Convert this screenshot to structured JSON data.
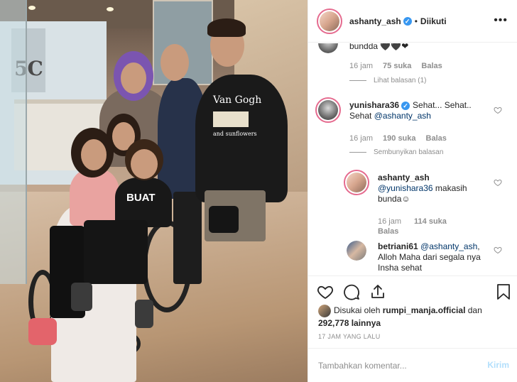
{
  "header": {
    "username": "ashanty_ash",
    "verified": true,
    "separator": "•",
    "follow_status": "Diikuti",
    "more_icon": "more-horizontal-icon"
  },
  "comments": [
    {
      "id": "partial",
      "text": "bundda 🖤🖤❤",
      "time": "16 jam",
      "likes": "75 suka",
      "reply": "Balas",
      "thread_toggle": "Lihat balasan (1)"
    },
    {
      "id": "yunishara",
      "username": "yunishara36",
      "verified": true,
      "text": "Sehat... Sehat.. Sehat ",
      "mention": "@ashanty_ash",
      "time": "16 jam",
      "likes": "190 suka",
      "reply": "Balas",
      "thread_toggle": "Sembunyikan balasan"
    },
    {
      "id": "ashanty-reply",
      "username": "ashanty_ash",
      "mention": "@yunishara36",
      "text": " makasih bunda☺",
      "time": "16 jam",
      "likes": "114 suka",
      "reply": "Balas"
    },
    {
      "id": "betriani",
      "username": "betriani61",
      "mention": "@ashanty_ash",
      "text": ", Alloh Maha dari segala nya Insha sehat"
    }
  ],
  "actions": {
    "like_icon": "heart-icon",
    "comment_icon": "comment-icon",
    "share_icon": "share-icon",
    "save_icon": "bookmark-icon"
  },
  "likes": {
    "prefix": "Disukai oleh ",
    "user": "rumpi_manja.official",
    "conj": " dan",
    "count": "292,778 lainnya"
  },
  "time_ago": "17 JAM YANG LALU",
  "footer": {
    "placeholder": "Tambahkan komentar...",
    "post_label": "Kirim"
  },
  "photo": {
    "sign_text": "5C",
    "shirt_text_1": "Van Gogh",
    "shirt_text_2": "and sunflowers",
    "shirt_text_3": "BUAT"
  },
  "colors": {
    "link": "#003569",
    "verified": "#3897f0",
    "muted": "#8e8e8e",
    "post_disabled": "#b2dffc"
  }
}
